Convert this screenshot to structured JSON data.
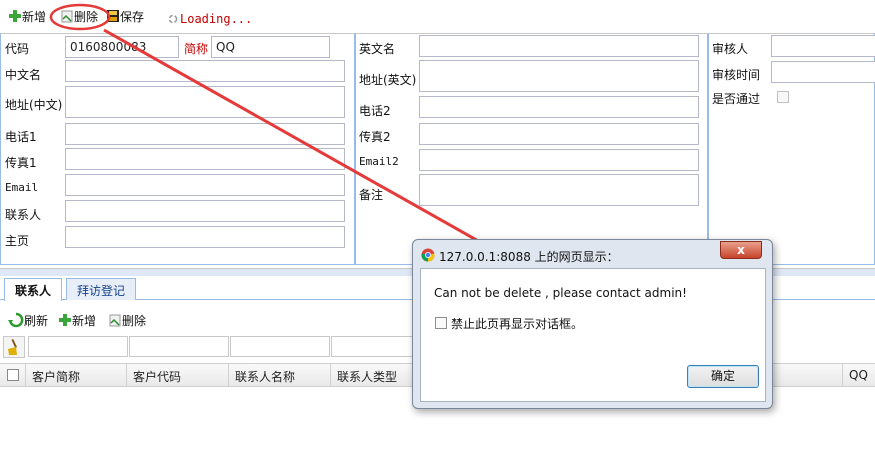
{
  "toolbar": {
    "add_label": "新增",
    "delete_label": "删除",
    "save_label": "保存",
    "loading_text": "Loading..."
  },
  "form": {
    "code_label": "代码",
    "code_value": "0160800083",
    "short_name_label": "简称",
    "short_name_value": "QQ",
    "cn_name_label": "中文名",
    "cn_address_label": "地址(中文)",
    "phone1_label": "电话1",
    "fax1_label": "传真1",
    "email_label": "Email",
    "contact_label": "联系人",
    "homepage_label": "主页",
    "en_name_label": "英文名",
    "en_address_label": "地址(英文)",
    "phone2_label": "电话2",
    "fax2_label": "传真2",
    "email2_label": "Email2",
    "remark_label": "备注",
    "reviewer_label": "审核人",
    "review_time_label": "审核时间",
    "approved_label": "是否通过"
  },
  "tabs": [
    {
      "label": "联系人",
      "active": true
    },
    {
      "label": "拜访登记",
      "active": false
    }
  ],
  "sub_toolbar": {
    "refresh_label": "刷新",
    "add_label": "新增",
    "delete_label": "删除"
  },
  "grid": {
    "columns": [
      "客户简称",
      "客户代码",
      "联系人名称",
      "联系人类型",
      "QQ"
    ]
  },
  "dialog": {
    "title": "127.0.0.1:8088 上的网页显示：",
    "close": "x",
    "message": "Can not be delete , please contact admin!",
    "suppress_label": "禁止此页再显示对话框。",
    "ok_label": "确定"
  },
  "colors": {
    "annotation": "#e53a3a",
    "accent": "#99bbe8",
    "loading": "#c00000"
  }
}
